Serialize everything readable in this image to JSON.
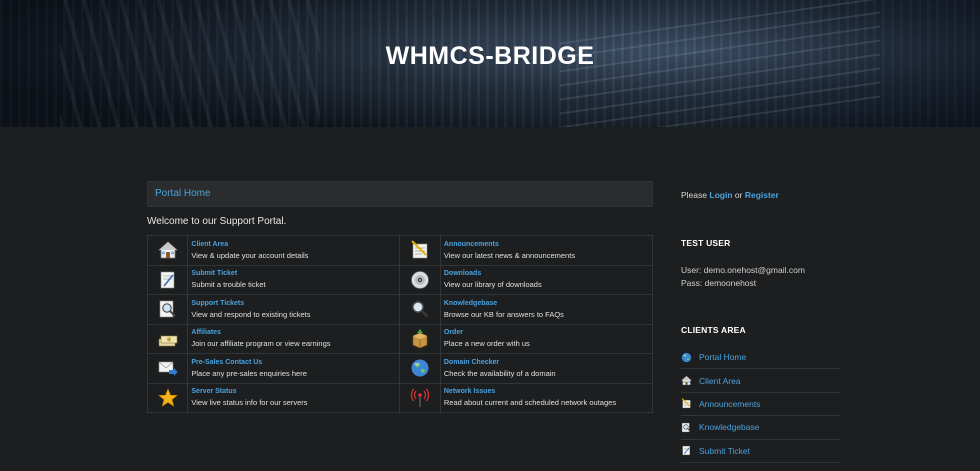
{
  "header": {
    "title": "WHMCS-BRIDGE"
  },
  "breadcrumb": {
    "home": "Portal Home"
  },
  "welcome": "Welcome to our Support Portal.",
  "grid": [
    [
      {
        "icon": "house-icon",
        "title": "Client Area",
        "desc": "View & update your account details"
      },
      {
        "icon": "announcement-icon",
        "title": "Announcements",
        "desc": "View our latest news & announcements"
      }
    ],
    [
      {
        "icon": "ticket-icon",
        "title": "Submit Ticket",
        "desc": "Submit a trouble ticket"
      },
      {
        "icon": "disc-icon",
        "title": "Downloads",
        "desc": "View our library of downloads"
      }
    ],
    [
      {
        "icon": "magnifier-doc-icon",
        "title": "Support Tickets",
        "desc": "View and respond to existing tickets"
      },
      {
        "icon": "magnifier-icon",
        "title": "Knowledgebase",
        "desc": "Browse our KB for answers to FAQs"
      }
    ],
    [
      {
        "icon": "money-icon",
        "title": "Affiliates",
        "desc": "Join our affiliate program or view earnings"
      },
      {
        "icon": "package-icon",
        "title": "Order",
        "desc": "Place a new order with us"
      }
    ],
    [
      {
        "icon": "contact-arrow-icon",
        "title": "Pre-Sales Contact Us",
        "desc": "Place any pre-sales enquiries here"
      },
      {
        "icon": "globe-icon",
        "title": "Domain Checker",
        "desc": "Check the availability of a domain"
      }
    ],
    [
      {
        "icon": "star-icon",
        "title": "Server Status",
        "desc": "View live status info for our servers"
      },
      {
        "icon": "antenna-icon",
        "title": "Network Issues",
        "desc": "Read about current and scheduled network outages"
      }
    ]
  ],
  "sidebar": {
    "login_prefix": "Please",
    "login_link": "Login",
    "login_or": "or",
    "register_link": "Register",
    "test_user_heading": "TEST USER",
    "test_user_line": "User: demo.onehost@gmail.com",
    "test_pass_line": "Pass: demoonehost",
    "clients_heading": "CLIENTS AREA",
    "client_links": [
      {
        "icon": "globe-icon",
        "label": "Portal Home"
      },
      {
        "icon": "house-icon",
        "label": "Client Area"
      },
      {
        "icon": "announcement-icon",
        "label": "Announcements"
      },
      {
        "icon": "magnifier-doc-icon",
        "label": "Knowledgebase"
      },
      {
        "icon": "ticket-icon",
        "label": "Submit Ticket"
      }
    ]
  }
}
